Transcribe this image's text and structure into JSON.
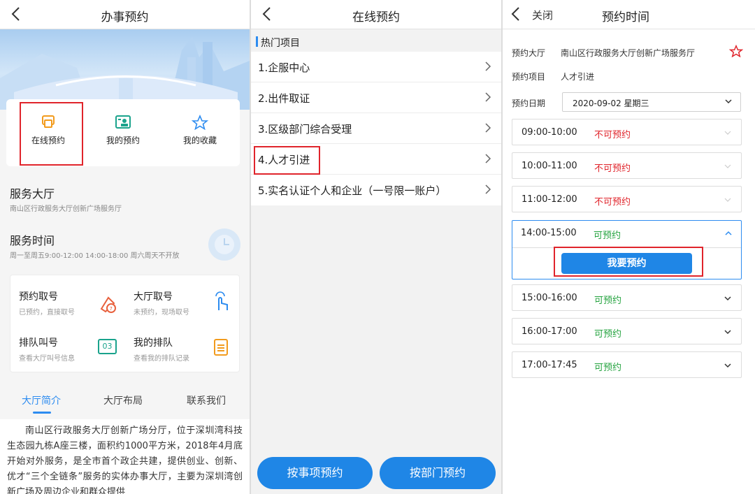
{
  "panel1": {
    "title": "办事预约",
    "quick": [
      "在线预约",
      "我的预约",
      "我的收藏"
    ],
    "hall_title": "服务大厅",
    "hall_name": "南山区行政服务大厅创新广场服务厅",
    "time_title": "服务时间",
    "time_text": "周一至周五9:00-12:00 14:00-18:00 周六周天不开放",
    "grid": [
      {
        "title": "预约取号",
        "sub": "已预约，直接取号"
      },
      {
        "title": "大厅取号",
        "sub": "未预约，现场取号"
      },
      {
        "title": "排队叫号",
        "sub": "查看大厅叫号信息"
      },
      {
        "title": "我的排队",
        "sub": "查看我的排队记录"
      }
    ],
    "queue_icon_text": "03",
    "tabs": [
      "大厅简介",
      "大厅布局",
      "联系我们"
    ],
    "intro": "南山区行政服务大厅创新广场分厅，位于深圳湾科技生态园九栋A座三楼，面积约1000平方米，2018年4月底开始对外服务，是全市首个政企共建，提供创业、创新、优才“三个全链条”服务的实体办事大厅，主要为深圳湾创新广场及周边企业和群众提供"
  },
  "panel2": {
    "title": "在线预约",
    "hot_label": "热门项目",
    "items": [
      "1.企服中心",
      "2.出件取证",
      "3.区级部门综合受理",
      "4.人才引进",
      "5.实名认证个人和企业（一号限一账户）"
    ],
    "btn_left": "按事项预约",
    "btn_right": "按部门预约"
  },
  "panel3": {
    "close": "关闭",
    "title": "预约时间",
    "hall_key": "预约大厅",
    "hall_val": "南山区行政服务大厅创新广场服务厅",
    "item_key": "预约项目",
    "item_val": "人才引进",
    "date_key": "预约日期",
    "date_val": "2020-09-02  星期三",
    "slots": [
      {
        "time": "09:00-10:00",
        "status": "不可预约"
      },
      {
        "time": "10:00-11:00",
        "status": "不可预约"
      },
      {
        "time": "11:00-12:00",
        "status": "不可预约"
      },
      {
        "time": "14:00-15:00",
        "status": "可预约"
      },
      {
        "time": "15:00-16:00",
        "status": "可预约"
      },
      {
        "time": "16:00-17:00",
        "status": "可预约"
      },
      {
        "time": "17:00-17:45",
        "status": "可预约"
      }
    ],
    "book_btn": "我要预约",
    "colors": {
      "primary": "#1f86e6",
      "unavailable": "#e0242b",
      "available": "#24a33f",
      "highlight": "#e0242b"
    }
  }
}
